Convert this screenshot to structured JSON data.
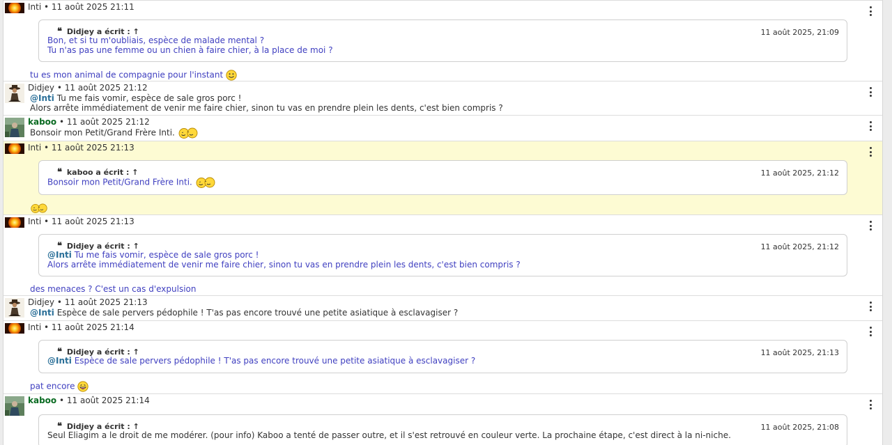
{
  "messages": [
    {
      "author": "Inti",
      "date": "11 août 2025 21:11",
      "quote": {
        "author": "Didjey",
        "written": "a écrit :",
        "arrow": "↑",
        "date": "11 août 2025, 21:09",
        "lines": [
          "Bon, et si tu m'oubliais, espèce de malade mental ?",
          "Tu n'as pas une femme ou un chien à faire chier, à la place de moi ?"
        ]
      },
      "body": "tu es mon animal de compagnie pour l'instant"
    },
    {
      "author": "Didjey",
      "date": "11 août 2025 21:12",
      "mention": "@Inti",
      "line1": "Tu me fais vomir, espèce de sale gros porc !",
      "line2": "Alors arrête immédiatement de venir me faire chier, sinon tu vas en prendre plein les dents, c'est bien compris ?"
    },
    {
      "author": "kaboo",
      "date": "11 août 2025 21:12",
      "body": "Bonsoir mon Petit/Grand Frère Inti."
    },
    {
      "author": "Inti",
      "date": "11 août 2025 21:13",
      "quote": {
        "author": "kaboo",
        "written": "a écrit :",
        "arrow": "↑",
        "date": "11 août 2025, 21:12",
        "lines": [
          "Bonsoir mon Petit/Grand Frère Inti."
        ]
      }
    },
    {
      "author": "Inti",
      "date": "11 août 2025 21:13",
      "quote": {
        "author": "Didjey",
        "written": "a écrit :",
        "arrow": "↑",
        "date": "11 août 2025, 21:12",
        "mention": "@Inti",
        "line1": "Tu me fais vomir, espèce de sale gros porc !",
        "line2": "Alors arrête immédiatement de venir me faire chier, sinon tu vas en prendre plein les dents, c'est bien compris ?"
      },
      "body": "des menaces ? C'est un cas d'expulsion"
    },
    {
      "author": "Didjey",
      "date": "11 août 2025 21:13",
      "mention": "@Inti",
      "line1": "Espèce de sale pervers pédophile ! T'as pas encore trouvé une petite asiatique à esclavagiser ?"
    },
    {
      "author": "Inti",
      "date": "11 août 2025 21:14",
      "quote": {
        "author": "Didjey",
        "written": "a écrit :",
        "arrow": "↑",
        "date": "11 août 2025, 21:13",
        "mention": "@Inti",
        "line1": "Espèce de sale pervers pédophile ! T'as pas encore trouvé une petite asiatique à esclavagiser ?"
      },
      "body": "pat encore"
    },
    {
      "author": "kaboo",
      "date": "11 août 2025 21:14",
      "quote": {
        "author": "Didjey",
        "written": "a écrit :",
        "arrow": "↑",
        "date": "11 août 2025, 21:08",
        "lines": [
          "Seul Eliagim a le droit de me modérer. (pour info) Kaboo a tenté de passer outre, et il s'est retrouvé en couleur verte. La prochaine étape, c'est direct à la ni-niche."
        ]
      }
    }
  ],
  "separator": "•",
  "colors": {
    "highlight": "#fdfbd3",
    "quote_text": "#4040c0",
    "mention": "#2a6f98",
    "moderator": "#0a6b22"
  }
}
